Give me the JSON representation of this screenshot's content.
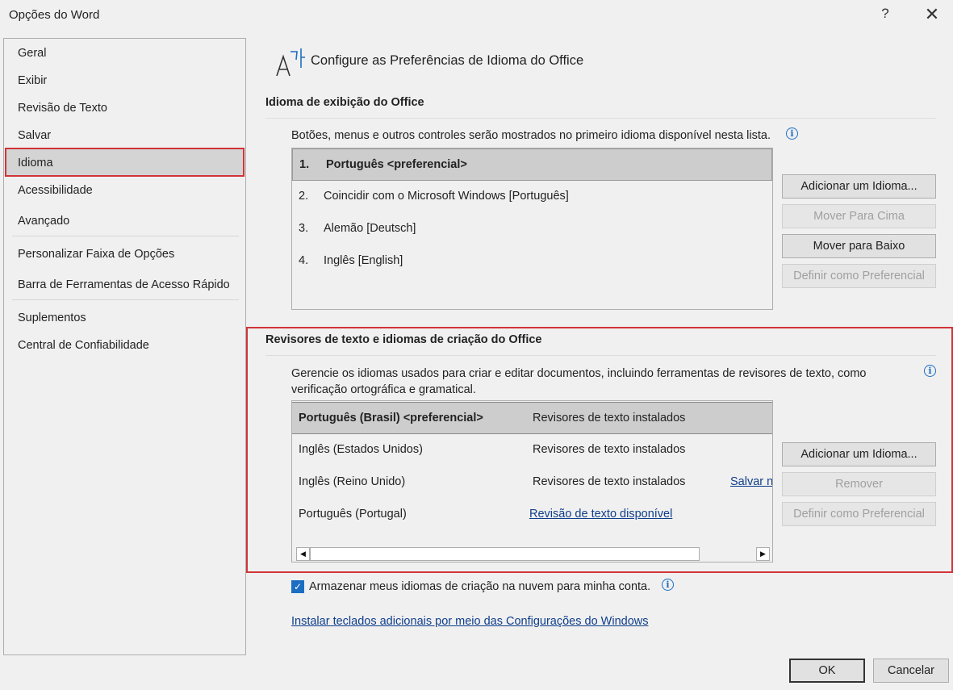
{
  "window": {
    "title": "Opções do Word",
    "help_glyph": "?",
    "close_glyph": "✕"
  },
  "sidebar": {
    "items": [
      {
        "label": "Geral"
      },
      {
        "label": "Exibir"
      },
      {
        "label": "Revisão de Texto"
      },
      {
        "label": "Salvar"
      },
      {
        "label": "Idioma",
        "selected": true
      },
      {
        "label": "Acessibilidade"
      },
      {
        "label": "Avançado"
      },
      {
        "label": "Personalizar Faixa de Opções"
      },
      {
        "label": "Barra de Ferramentas de Acesso Rápido"
      },
      {
        "label": "Suplementos"
      },
      {
        "label": "Central de Confiabilidade"
      }
    ]
  },
  "header": {
    "icon": "language-icon",
    "title": "Configure as Preferências de Idioma do Office"
  },
  "display_section": {
    "title": "Idioma de exibição do Office",
    "description": "Botões, menus e outros controles serão mostrados no primeiro idioma disponível nesta lista.",
    "languages": [
      {
        "num": "1.",
        "label": "Português <preferencial>",
        "selected": true
      },
      {
        "num": "2.",
        "label": "Coincidir com o Microsoft Windows [Português]"
      },
      {
        "num": "3.",
        "label": "Alemão [Deutsch]"
      },
      {
        "num": "4.",
        "label": "Inglês [English]"
      }
    ],
    "buttons": {
      "add": "Adicionar um Idioma...",
      "move_up": "Mover Para Cima",
      "move_down": "Mover para Baixo",
      "set_preferred": "Definir como Preferencial"
    }
  },
  "authoring_section": {
    "title": "Revisores de texto e idiomas de criação do Office",
    "description_line1": "Gerencie os idiomas usados para criar e editar documentos, incluindo ferramentas de revisores de texto, como",
    "description_line2": "verificação ortográfica e gramatical.",
    "rows": [
      {
        "language": "Português (Brasil) <preferencial>",
        "status": "Revisores de texto instalados",
        "extra": "",
        "selected": true
      },
      {
        "language": "Inglês (Estados Unidos)",
        "status": "Revisores de texto instalados",
        "extra": ""
      },
      {
        "language": "Inglês (Reino Unido)",
        "status": "Revisores de texto instalados",
        "extra": "Salvar n"
      },
      {
        "language": "Português (Portugal)",
        "status": "Revisão de texto disponível",
        "extra": ""
      }
    ],
    "buttons": {
      "add": "Adicionar um Idioma...",
      "remove": "Remover",
      "set_preferred": "Definir como Preferencial"
    }
  },
  "options": {
    "cloud_checkbox_label": "Armazenar meus idiomas de criação na nuvem para minha conta.",
    "cloud_checked": true,
    "keyboards_link": "Instalar teclados adicionais por meio das Configurações do Windows"
  },
  "footer": {
    "ok": "OK",
    "cancel": "Cancelar"
  },
  "colors": {
    "highlight_frame": "#d13438",
    "link": "#0f3e8c",
    "checkbox": "#1b6ec2"
  }
}
